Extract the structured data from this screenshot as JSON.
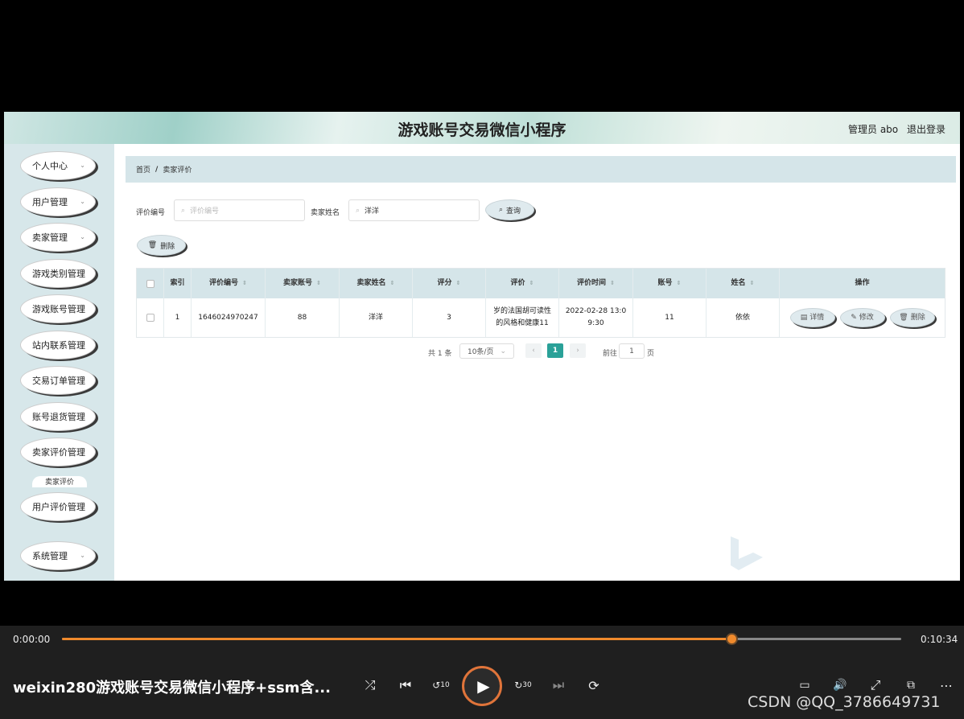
{
  "header": {
    "title": "游戏账号交易微信小程序",
    "admin": "管理员 abo",
    "logout": "退出登录"
  },
  "sidebar": {
    "items": [
      {
        "label": "个人中心"
      },
      {
        "label": "用户管理"
      },
      {
        "label": "卖家管理"
      },
      {
        "label": "游戏类别管理"
      },
      {
        "label": "游戏账号管理"
      },
      {
        "label": "站内联系管理"
      },
      {
        "label": "交易订单管理"
      },
      {
        "label": "账号退货管理"
      },
      {
        "label": "卖家评价管理"
      },
      {
        "label": "用户评价管理"
      },
      {
        "label": "系统管理"
      }
    ],
    "sub_item": "卖家评价"
  },
  "breadcrumb": {
    "home": "首页",
    "separator": "/",
    "current": "卖家评价"
  },
  "search": {
    "review_id_label": "评价编号",
    "review_id_placeholder": "评价编号",
    "seller_name_label": "卖家姓名",
    "seller_name_value": "洋洋",
    "query_button": "查询",
    "delete_button": "删除"
  },
  "table": {
    "headers": [
      "索引",
      "评价编号",
      "卖家账号",
      "卖家姓名",
      "评分",
      "评价",
      "评价时间",
      "账号",
      "姓名",
      "操作"
    ],
    "rows": [
      {
        "index": "1",
        "review_id": "1646024970247",
        "seller_account": "88",
        "seller_name": "洋洋",
        "score": "3",
        "review_line1": "岁的法国胡可读性",
        "review_line2": "的风格和健康11",
        "time_line1": "2022-02-28 13:0",
        "time_line2": "9:30",
        "account": "11",
        "name": "依依",
        "actions": [
          "详情",
          "修改",
          "删除"
        ]
      }
    ]
  },
  "pagination": {
    "total": "共 1 条",
    "page_size": "10条/页",
    "prev": "‹",
    "current_page": "1",
    "next": "›",
    "goto_label": "前往",
    "goto_value": "1",
    "page_suffix": "页"
  },
  "player": {
    "current_time": "0:00:00",
    "total_time": "0:10:34",
    "progress": 0.798,
    "title": "weixin280游戏账号交易微信小程序+ssm含...",
    "watermark": "CSDN @QQ_3786649731",
    "skip_back": "10",
    "skip_forward": "30"
  },
  "colors": {
    "accent_orange": "#f08a2c",
    "pager_active": "#2aa198",
    "sidebar_bg": "#d7e7ea",
    "header_strip_bg": "#d5e5e9"
  }
}
